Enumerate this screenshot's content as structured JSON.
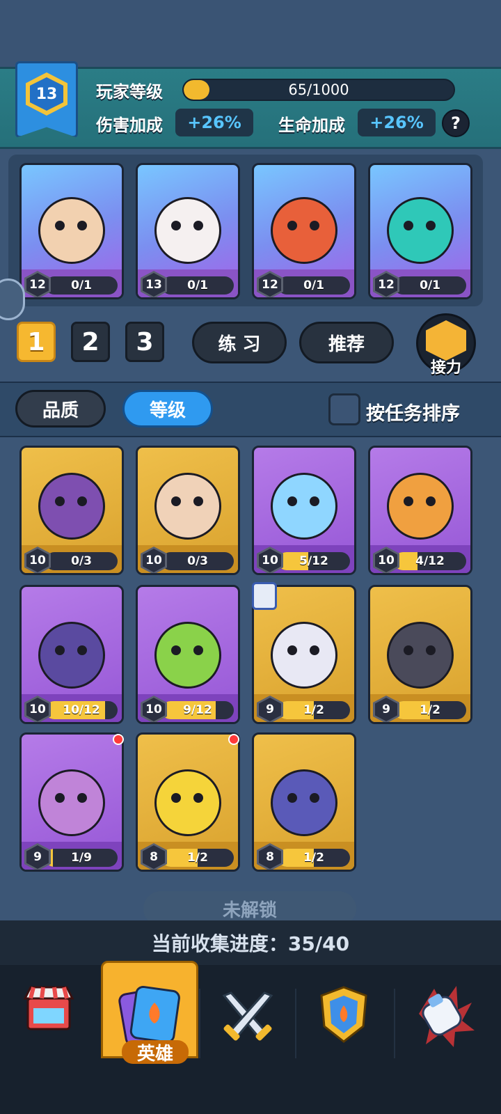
{
  "player": {
    "level": "13",
    "level_label": "玩家等级",
    "xp_text": "65/1000",
    "xp_fraction": 0.065,
    "damage_label": "伤害加成",
    "damage_value": "+26%",
    "hp_label": "生命加成",
    "hp_value": "+26%",
    "help": "?"
  },
  "team": [
    {
      "level": "12",
      "progress": "0/1",
      "fill": 0,
      "frame": "blue",
      "hero": "monk-hero",
      "color": "#f2d1b0"
    },
    {
      "level": "13",
      "progress": "0/1",
      "fill": 0,
      "frame": "blue",
      "hero": "monkey-king-hero",
      "color": "#f5f0f0"
    },
    {
      "level": "12",
      "progress": "0/1",
      "fill": 0,
      "frame": "blue",
      "hero": "dragon-hero",
      "color": "#e8603a"
    },
    {
      "level": "12",
      "progress": "0/1",
      "fill": 0,
      "frame": "blue",
      "hero": "spirit-hero",
      "color": "#2fc8b8"
    }
  ],
  "team_tabs": [
    "1",
    "2",
    "3"
  ],
  "buttons": {
    "practice": "练 习",
    "recommend": "推荐",
    "relay": "接力"
  },
  "filters": {
    "quality": "品质",
    "level": "等级",
    "sort_by_task": "按任务排序"
  },
  "heroes": [
    {
      "level": "10",
      "progress": "0/3",
      "fill": 0,
      "frame": "gold",
      "hero": "bat-hero",
      "color": "#7e4fb0"
    },
    {
      "level": "10",
      "progress": "0/3",
      "fill": 0,
      "frame": "gold",
      "hero": "old-warrior-hero",
      "color": "#f0d2b8"
    },
    {
      "level": "10",
      "progress": "5/12",
      "fill": 0.4167,
      "frame": "purple",
      "hero": "slime-hero",
      "color": "#8fd6ff"
    },
    {
      "level": "10",
      "progress": "4/12",
      "fill": 0.3333,
      "frame": "purple",
      "hero": "tiger-pirate-hero",
      "color": "#f0a040"
    },
    {
      "level": "10",
      "progress": "10/12",
      "fill": 0.8333,
      "frame": "purple",
      "hero": "minotaur-hero",
      "color": "#5a4aa0"
    },
    {
      "level": "10",
      "progress": "9/12",
      "fill": 0.75,
      "frame": "purple",
      "hero": "dryad-hero",
      "color": "#8ad24a"
    },
    {
      "level": "9",
      "progress": "1/2",
      "fill": 0.5,
      "frame": "gold",
      "hero": "vampire-hero",
      "color": "#e8e8f4"
    },
    {
      "level": "9",
      "progress": "1/2",
      "fill": 0.5,
      "frame": "gold",
      "hero": "wolf-hero",
      "color": "#4a4a5a"
    },
    {
      "level": "9",
      "progress": "1/9",
      "fill": 0.1111,
      "frame": "purple",
      "hero": "gorilla-hero",
      "color": "#c084d8"
    },
    {
      "level": "8",
      "progress": "1/2",
      "fill": 0.5,
      "frame": "gold",
      "hero": "chicken-hero",
      "color": "#f5d43a"
    },
    {
      "level": "8",
      "progress": "1/2",
      "fill": 0.5,
      "frame": "gold",
      "hero": "shadow-knight-hero",
      "color": "#5a5ab8"
    }
  ],
  "locked_label": "未解锁",
  "collection_progress": "当前收集进度：35/40",
  "nav": {
    "shop": "shop-icon",
    "heroes": "英雄",
    "battle": "crossed-swords-icon",
    "rank": "shield-icon",
    "gear": "gauntlet-icon"
  },
  "colors": {
    "accent": "#f7b22e",
    "boost": "#58c5ff",
    "panel": "#2b7d86"
  }
}
